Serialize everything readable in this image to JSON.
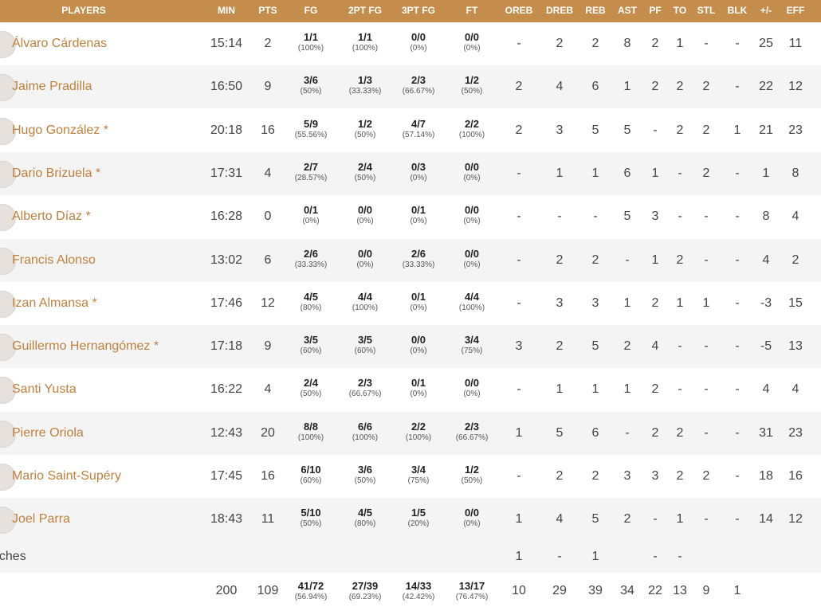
{
  "headers": {
    "players": "PLAYERS",
    "min": "MIN",
    "pts": "PTS",
    "fg": "FG",
    "fg2": "2PT FG",
    "fg3": "3PT FG",
    "ft": "FT",
    "oreb": "OREB",
    "dreb": "DREB",
    "reb": "REB",
    "ast": "AST",
    "pf": "PF",
    "to": "TO",
    "stl": "STL",
    "blk": "BLK",
    "pm": "+/-",
    "eff": "EFF"
  },
  "players": [
    {
      "name": "Álvaro Cárdenas",
      "min": "15:14",
      "pts": "2",
      "fg": {
        "m": "1/1",
        "p": "(100%)"
      },
      "fg2": {
        "m": "1/1",
        "p": "(100%)"
      },
      "fg3": {
        "m": "0/0",
        "p": "(0%)"
      },
      "ft": {
        "m": "0/0",
        "p": "(0%)"
      },
      "oreb": "-",
      "dreb": "2",
      "reb": "2",
      "ast": "8",
      "pf": "2",
      "to": "1",
      "stl": "-",
      "blk": "-",
      "pm": "25",
      "eff": "11"
    },
    {
      "name": "Jaime Pradilla",
      "min": "16:50",
      "pts": "9",
      "fg": {
        "m": "3/6",
        "p": "(50%)"
      },
      "fg2": {
        "m": "1/3",
        "p": "(33.33%)"
      },
      "fg3": {
        "m": "2/3",
        "p": "(66.67%)"
      },
      "ft": {
        "m": "1/2",
        "p": "(50%)"
      },
      "oreb": "2",
      "dreb": "4",
      "reb": "6",
      "ast": "1",
      "pf": "2",
      "to": "2",
      "stl": "2",
      "blk": "-",
      "pm": "22",
      "eff": "12"
    },
    {
      "name": "Hugo González *",
      "min": "20:18",
      "pts": "16",
      "fg": {
        "m": "5/9",
        "p": "(55.56%)"
      },
      "fg2": {
        "m": "1/2",
        "p": "(50%)"
      },
      "fg3": {
        "m": "4/7",
        "p": "(57.14%)"
      },
      "ft": {
        "m": "2/2",
        "p": "(100%)"
      },
      "oreb": "2",
      "dreb": "3",
      "reb": "5",
      "ast": "5",
      "pf": "-",
      "to": "2",
      "stl": "2",
      "blk": "1",
      "pm": "21",
      "eff": "23"
    },
    {
      "name": "Dario Brizuela *",
      "min": "17:31",
      "pts": "4",
      "fg": {
        "m": "2/7",
        "p": "(28.57%)"
      },
      "fg2": {
        "m": "2/4",
        "p": "(50%)"
      },
      "fg3": {
        "m": "0/3",
        "p": "(0%)"
      },
      "ft": {
        "m": "0/0",
        "p": "(0%)"
      },
      "oreb": "-",
      "dreb": "1",
      "reb": "1",
      "ast": "6",
      "pf": "1",
      "to": "-",
      "stl": "2",
      "blk": "-",
      "pm": "1",
      "eff": "8"
    },
    {
      "name": "Alberto Díaz *",
      "min": "16:28",
      "pts": "0",
      "fg": {
        "m": "0/1",
        "p": "(0%)"
      },
      "fg2": {
        "m": "0/0",
        "p": "(0%)"
      },
      "fg3": {
        "m": "0/1",
        "p": "(0%)"
      },
      "ft": {
        "m": "0/0",
        "p": "(0%)"
      },
      "oreb": "-",
      "dreb": "-",
      "reb": "-",
      "ast": "5",
      "pf": "3",
      "to": "-",
      "stl": "-",
      "blk": "-",
      "pm": "8",
      "eff": "4"
    },
    {
      "name": "Francis Alonso",
      "min": "13:02",
      "pts": "6",
      "fg": {
        "m": "2/6",
        "p": "(33.33%)"
      },
      "fg2": {
        "m": "0/0",
        "p": "(0%)"
      },
      "fg3": {
        "m": "2/6",
        "p": "(33.33%)"
      },
      "ft": {
        "m": "0/0",
        "p": "(0%)"
      },
      "oreb": "-",
      "dreb": "2",
      "reb": "2",
      "ast": "-",
      "pf": "1",
      "to": "2",
      "stl": "-",
      "blk": "-",
      "pm": "4",
      "eff": "2"
    },
    {
      "name": "Izan Almansa *",
      "min": "17:46",
      "pts": "12",
      "fg": {
        "m": "4/5",
        "p": "(80%)"
      },
      "fg2": {
        "m": "4/4",
        "p": "(100%)"
      },
      "fg3": {
        "m": "0/1",
        "p": "(0%)"
      },
      "ft": {
        "m": "4/4",
        "p": "(100%)"
      },
      "oreb": "-",
      "dreb": "3",
      "reb": "3",
      "ast": "1",
      "pf": "2",
      "to": "1",
      "stl": "1",
      "blk": "-",
      "pm": "-3",
      "eff": "15"
    },
    {
      "name": "Guillermo Hernangómez *",
      "min": "17:18",
      "pts": "9",
      "fg": {
        "m": "3/5",
        "p": "(60%)"
      },
      "fg2": {
        "m": "3/5",
        "p": "(60%)"
      },
      "fg3": {
        "m": "0/0",
        "p": "(0%)"
      },
      "ft": {
        "m": "3/4",
        "p": "(75%)"
      },
      "oreb": "3",
      "dreb": "2",
      "reb": "5",
      "ast": "2",
      "pf": "4",
      "to": "-",
      "stl": "-",
      "blk": "-",
      "pm": "-5",
      "eff": "13"
    },
    {
      "name": "Santi Yusta",
      "min": "16:22",
      "pts": "4",
      "fg": {
        "m": "2/4",
        "p": "(50%)"
      },
      "fg2": {
        "m": "2/3",
        "p": "(66.67%)"
      },
      "fg3": {
        "m": "0/1",
        "p": "(0%)"
      },
      "ft": {
        "m": "0/0",
        "p": "(0%)"
      },
      "oreb": "-",
      "dreb": "1",
      "reb": "1",
      "ast": "1",
      "pf": "2",
      "to": "-",
      "stl": "-",
      "blk": "-",
      "pm": "4",
      "eff": "4"
    },
    {
      "name": "Pierre Oriola",
      "min": "12:43",
      "pts": "20",
      "fg": {
        "m": "8/8",
        "p": "(100%)"
      },
      "fg2": {
        "m": "6/6",
        "p": "(100%)"
      },
      "fg3": {
        "m": "2/2",
        "p": "(100%)"
      },
      "ft": {
        "m": "2/3",
        "p": "(66.67%)"
      },
      "oreb": "1",
      "dreb": "5",
      "reb": "6",
      "ast": "-",
      "pf": "2",
      "to": "2",
      "stl": "-",
      "blk": "-",
      "pm": "31",
      "eff": "23"
    },
    {
      "name": "Mario Saint-Supéry",
      "min": "17:45",
      "pts": "16",
      "fg": {
        "m": "6/10",
        "p": "(60%)"
      },
      "fg2": {
        "m": "3/6",
        "p": "(50%)"
      },
      "fg3": {
        "m": "3/4",
        "p": "(75%)"
      },
      "ft": {
        "m": "1/2",
        "p": "(50%)"
      },
      "oreb": "-",
      "dreb": "2",
      "reb": "2",
      "ast": "3",
      "pf": "3",
      "to": "2",
      "stl": "2",
      "blk": "-",
      "pm": "18",
      "eff": "16"
    },
    {
      "name": "Joel Parra",
      "min": "18:43",
      "pts": "11",
      "fg": {
        "m": "5/10",
        "p": "(50%)"
      },
      "fg2": {
        "m": "4/5",
        "p": "(80%)"
      },
      "fg3": {
        "m": "1/5",
        "p": "(20%)"
      },
      "ft": {
        "m": "0/0",
        "p": "(0%)"
      },
      "oreb": "1",
      "dreb": "4",
      "reb": "5",
      "ast": "2",
      "pf": "-",
      "to": "1",
      "stl": "-",
      "blk": "-",
      "pm": "14",
      "eff": "12"
    }
  ],
  "coaches": {
    "label": "aches",
    "oreb": "1",
    "dreb": "-",
    "reb": "1",
    "pf": "-",
    "to": "-"
  },
  "totals": {
    "min": "200",
    "pts": "109",
    "fg": {
      "m": "41/72",
      "p": "(56.94%)"
    },
    "fg2": {
      "m": "27/39",
      "p": "(69.23%)"
    },
    "fg3": {
      "m": "14/33",
      "p": "(42.42%)"
    },
    "ft": {
      "m": "13/17",
      "p": "(76.47%)"
    },
    "oreb": "10",
    "dreb": "29",
    "reb": "39",
    "ast": "34",
    "pf": "22",
    "to": "13",
    "stl": "9",
    "blk": "1"
  },
  "colors": {
    "header_bg": "#c58d4c",
    "player_link": "#c0803e",
    "row_alt": "#f4f4f4"
  }
}
